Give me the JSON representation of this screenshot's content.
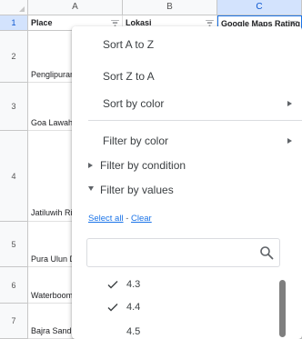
{
  "columns": [
    {
      "letter": "A",
      "selected": false
    },
    {
      "letter": "B",
      "selected": false
    },
    {
      "letter": "C",
      "selected": true
    }
  ],
  "rows": [
    {
      "num": "1",
      "selected": true
    },
    {
      "num": "2",
      "selected": false
    },
    {
      "num": "3",
      "selected": false
    },
    {
      "num": "4",
      "selected": false
    },
    {
      "num": "5",
      "selected": false
    },
    {
      "num": "6",
      "selected": false
    },
    {
      "num": "7",
      "selected": false
    }
  ],
  "header": {
    "place": "Place",
    "lokasi": "Lokasi",
    "rating": "Google Maps Rating"
  },
  "places": [
    "Penglipuran",
    "Goa Lawah T",
    "Jatiluwih Ric in Bali",
    "Pura Ulun D",
    "Waterboom",
    "Bajra Sandh"
  ],
  "menu": {
    "sort_az": "Sort A to Z",
    "sort_za": "Sort Z to A",
    "sort_color": "Sort by color",
    "filter_color": "Filter by color",
    "filter_condition": "Filter by condition",
    "filter_values": "Filter by values",
    "select_all": "Select all",
    "separator": " - ",
    "clear": "Clear",
    "search_placeholder": "",
    "values": [
      {
        "label": "4.3",
        "checked": true
      },
      {
        "label": "4.4",
        "checked": true
      },
      {
        "label": "4.5",
        "checked": false
      }
    ]
  },
  "colors": {
    "selected_header_bg": "#d3e3fd",
    "selected_header_text": "#0b57d0",
    "link": "#1a73e8"
  },
  "icons": {
    "filter": "filter-icon",
    "search": "search-icon",
    "check": "check-icon",
    "submenu": "chevron-right-icon"
  }
}
